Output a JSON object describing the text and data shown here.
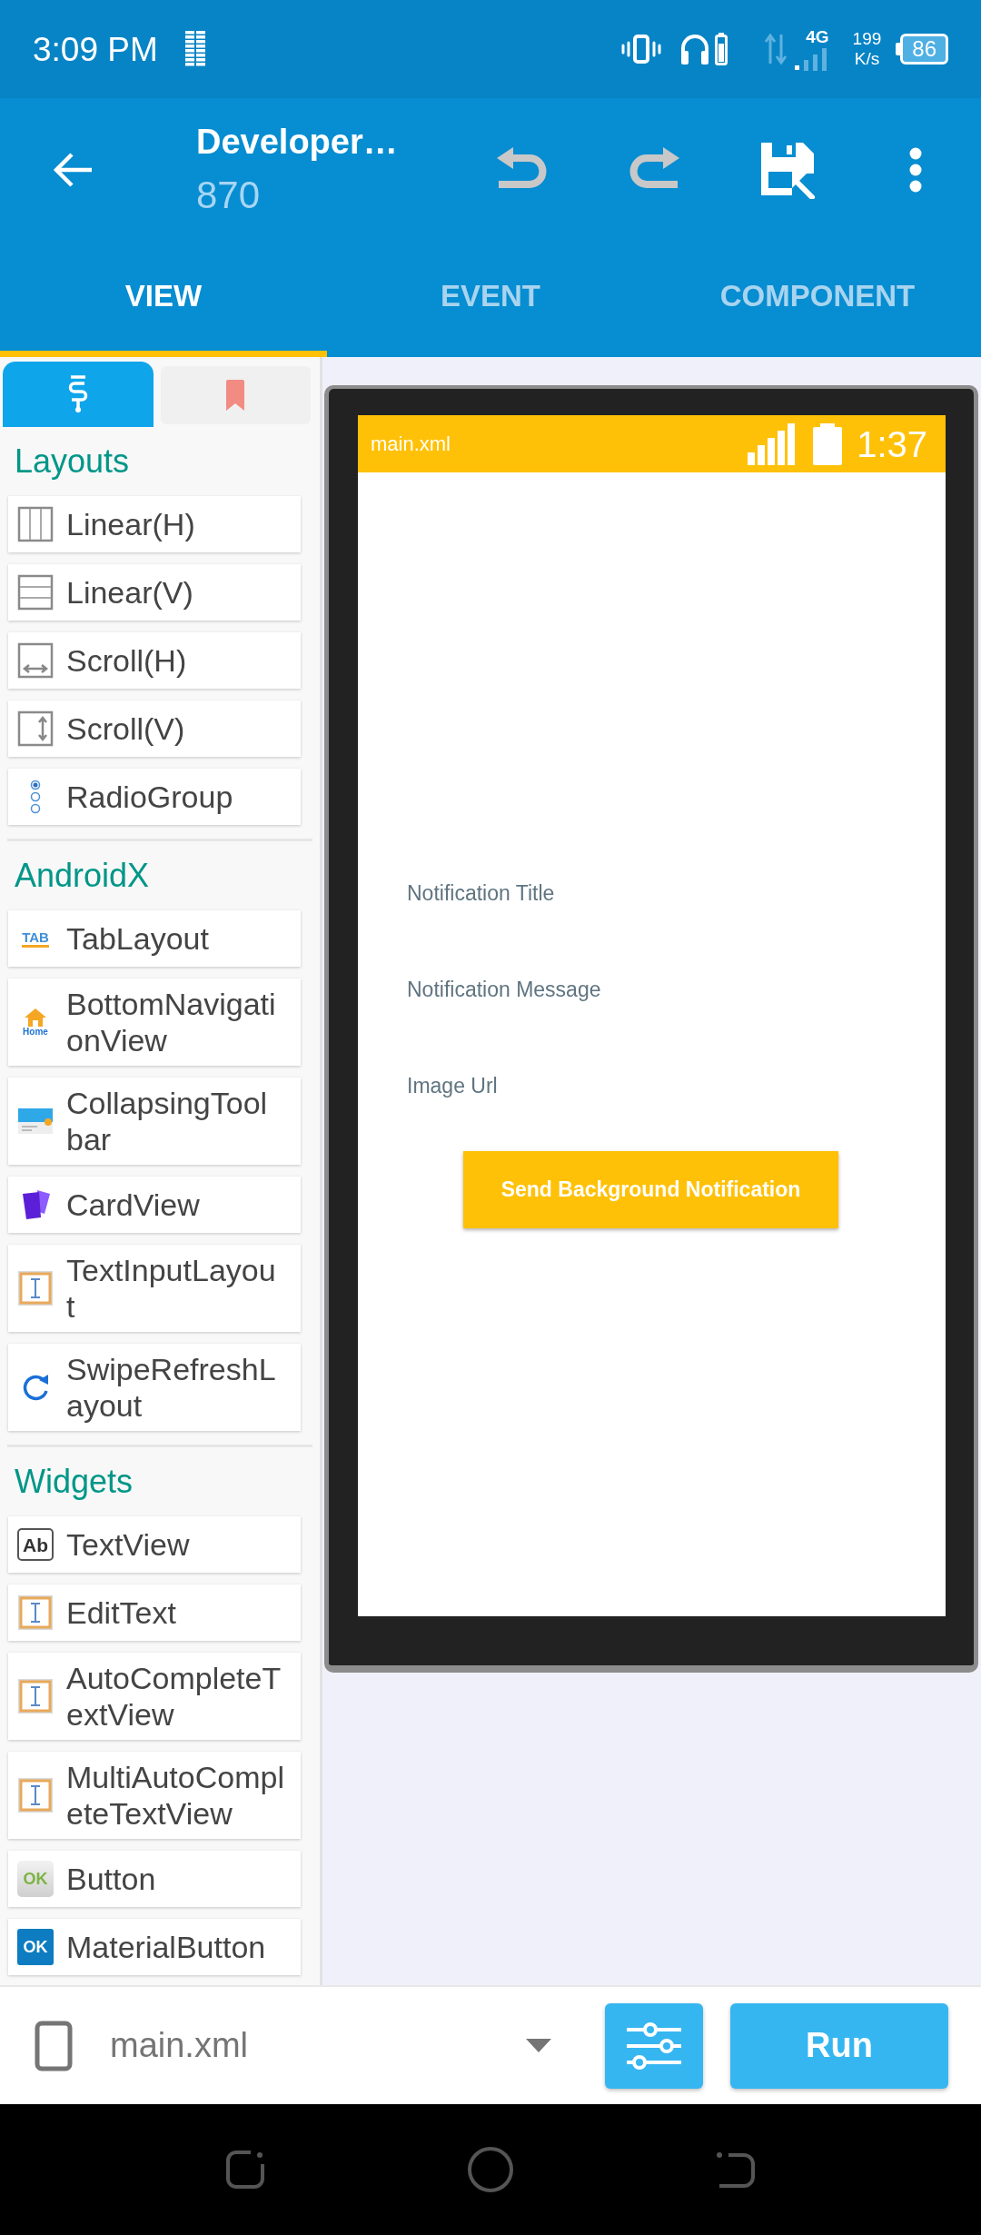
{
  "status_bar": {
    "time": "3:09 PM",
    "network": "4G",
    "speed": "199",
    "speed_unit": "K/s",
    "battery": "86"
  },
  "toolbar": {
    "title": "Developer…",
    "subtitle": "870",
    "actions": [
      {
        "kind": "undo",
        "disabled": true
      },
      {
        "kind": "redo",
        "disabled": true
      },
      {
        "kind": "save",
        "disabled": false
      },
      {
        "kind": "more",
        "disabled": false
      }
    ]
  },
  "tabs": [
    {
      "label": "VIEW",
      "selected": true
    },
    {
      "label": "EVENT",
      "selected": false
    },
    {
      "label": "COMPONENT",
      "selected": false
    }
  ],
  "palette": {
    "modes": [
      {
        "kind": "widgets",
        "selected": true
      },
      {
        "kind": "bookmarks",
        "selected": false
      }
    ],
    "sections": [
      {
        "title": "Layouts",
        "items": [
          {
            "label": "Linear(H)",
            "kind": "hlinear"
          },
          {
            "label": "Linear(V)",
            "kind": "vlinear"
          },
          {
            "label": "Scroll(H)",
            "kind": "hscroll"
          },
          {
            "label": "Scroll(V)",
            "kind": "vscroll"
          },
          {
            "label": "RadioGroup",
            "kind": "radio"
          }
        ]
      },
      {
        "title": "AndroidX",
        "items": [
          {
            "label": "TabLayout",
            "kind": "tab",
            "icon_text": "TAB"
          },
          {
            "label": "BottomNavigationView",
            "kind": "home",
            "icon_text": "Home"
          },
          {
            "label": "CollapsingToolbar",
            "kind": "toolbar"
          },
          {
            "label": "CardView",
            "kind": "card"
          },
          {
            "label": "TextInputLayout",
            "kind": "input"
          },
          {
            "label": "SwipeRefreshLayout",
            "kind": "refresh"
          }
        ]
      },
      {
        "title": "Widgets",
        "items": [
          {
            "label": "TextView",
            "kind": "text",
            "icon_text": "Ab"
          },
          {
            "label": "EditText",
            "kind": "input"
          },
          {
            "label": "AutoCompleteTextView",
            "kind": "input"
          },
          {
            "label": "MultiAutoCompleteTextView",
            "kind": "input"
          },
          {
            "label": "Button",
            "kind": "button",
            "icon_text": "OK"
          },
          {
            "label": "MaterialButton",
            "kind": "material",
            "icon_text": "OK"
          }
        ]
      }
    ]
  },
  "preview": {
    "app_bar": {
      "title": "main.xml",
      "time": "1:37"
    },
    "hints": [
      "Notification Title",
      "Notification Message",
      "Image Url"
    ],
    "button": "Send Background Notification"
  },
  "bottom_bar": {
    "file": "main.xml",
    "run": "Run"
  }
}
